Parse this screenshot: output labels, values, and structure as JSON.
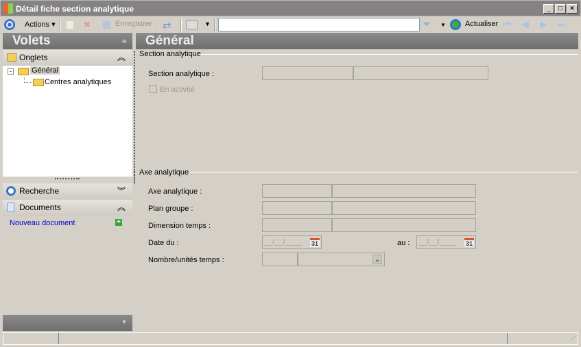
{
  "window": {
    "title": "Détail fiche section analytique",
    "minimize": "_",
    "maximize": "□",
    "close": "×"
  },
  "toolbar": {
    "actions": "Actions",
    "save": "Enregistrer",
    "search_value": "",
    "refresh": "Actualiser"
  },
  "left_panel": {
    "title": "Volets",
    "collapse": "«",
    "onglets": {
      "label": "Onglets",
      "tree": [
        {
          "label": "Général",
          "selected": true
        },
        {
          "label": "Centres analytiques"
        }
      ]
    },
    "recherche": {
      "label": "Recherche"
    },
    "documents": {
      "label": "Documents",
      "new_document": "Nouveau document"
    }
  },
  "main": {
    "title": "Général",
    "section1": {
      "title": "Section analytique",
      "section_label": "Section analytique :",
      "active_label": "En activité",
      "active_checked": false
    },
    "section2": {
      "title": "Axe analytique",
      "axe_label": "Axe analytique :",
      "plan_label": "Plan groupe :",
      "dimension_label": "Dimension temps :",
      "date_from_label": "Date du :",
      "date_to_label": "au :",
      "date_mask": "__/__/____",
      "calendar_day": "31",
      "units_label": "Nombre/unités temps :"
    }
  }
}
